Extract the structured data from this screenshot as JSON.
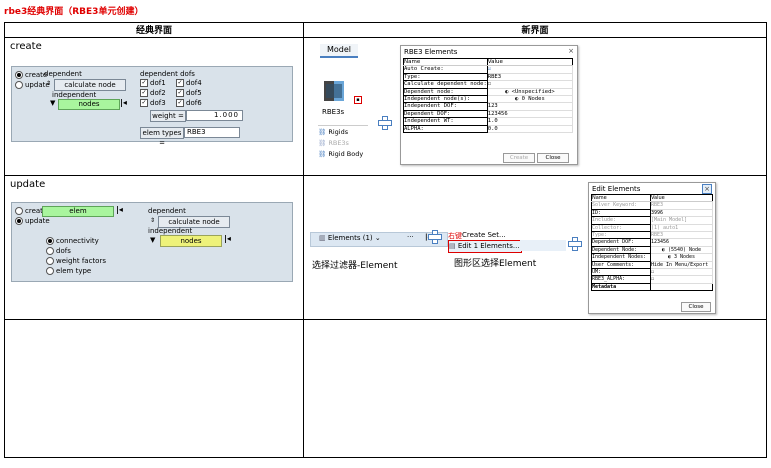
{
  "title": "rbe3经典界面（RBE3单元创建）",
  "header": {
    "left": "经典界面",
    "right": "新界面"
  },
  "rows": {
    "create": "create",
    "update": "update"
  },
  "create_panel": {
    "radio_create": "create",
    "radio_update": "update",
    "dependent": "dependent",
    "calculate_node": "calculate node",
    "independent": "independent",
    "nodes": "nodes",
    "dependent_dofs": "dependent dofs",
    "dofs": [
      "dof1",
      "dof4",
      "dof2",
      "dof5",
      "dof3",
      "dof6"
    ],
    "weight_label": "weight =",
    "weight_value": "1.000",
    "elem_types_label": "elem types =",
    "elem_types_value": "RBE3"
  },
  "create_new": {
    "model_tab": "Model",
    "rbe3_label": "RBE3s",
    "tree": [
      "Rigids",
      "RBE3s",
      "Rigid Body"
    ],
    "dialog": {
      "title": "RBE3 Elements",
      "close": "×",
      "col_name": "Name",
      "col_value": "Value",
      "rows": [
        [
          "Auto Create:",
          "☑"
        ],
        [
          "Type:",
          "RBE3"
        ],
        [
          "Calculate dependent node:",
          "☐"
        ],
        [
          "Dependent node:",
          "◐ <Unspecified>"
        ],
        [
          "Independent node(s):",
          "◐ 0 Nodes"
        ],
        [
          "Independent DOF:",
          "123"
        ],
        [
          "Dependent DOF:",
          "123456"
        ],
        [
          "Independent WT:",
          "1.0"
        ],
        [
          "ALPHA:",
          "0.0"
        ]
      ],
      "btn_create": "Create",
      "btn_close": "Close"
    }
  },
  "update_panel": {
    "radio_create": "create",
    "radio_update": "update",
    "elem": "elem",
    "dependent": "dependent",
    "calculate_node": "calculate node",
    "independent": "independent",
    "nodes": "nodes",
    "options": [
      "connectivity",
      "dofs",
      "weight factors",
      "elem type"
    ]
  },
  "update_new": {
    "filter_btn": "Elements (1)",
    "ellipsis": "···",
    "right_click": "右键",
    "menu_create_set": "Create Set...",
    "menu_edit": "Edit 1 Elements...",
    "caption_left": "选择过滤器-Element",
    "caption_right": "图形区选择Element",
    "dialog": {
      "title": "Edit Elements",
      "close": "×",
      "col_name": "Name",
      "col_value": "Value",
      "rows": [
        [
          "Solver Keyword:",
          "RBE3"
        ],
        [
          "ID:",
          "3996"
        ],
        [
          "Include:",
          "[Main Model]"
        ],
        [
          "Collector:",
          "(1) auto1"
        ],
        [
          "Type:",
          "RBE3"
        ],
        [
          "Dependent DOF:",
          "123456"
        ],
        [
          "Dependent Node:",
          "◐ (5540) Node"
        ],
        [
          "Independent Nodes:",
          "◐ 3 Nodes"
        ],
        [
          "User Comments:",
          "Hide In Menu/Export"
        ],
        [
          "UM:",
          "☐"
        ],
        [
          "RBE3_ALPHA:",
          "☐"
        ],
        [
          "Metadata",
          ""
        ]
      ],
      "btn_close": "Close"
    }
  }
}
